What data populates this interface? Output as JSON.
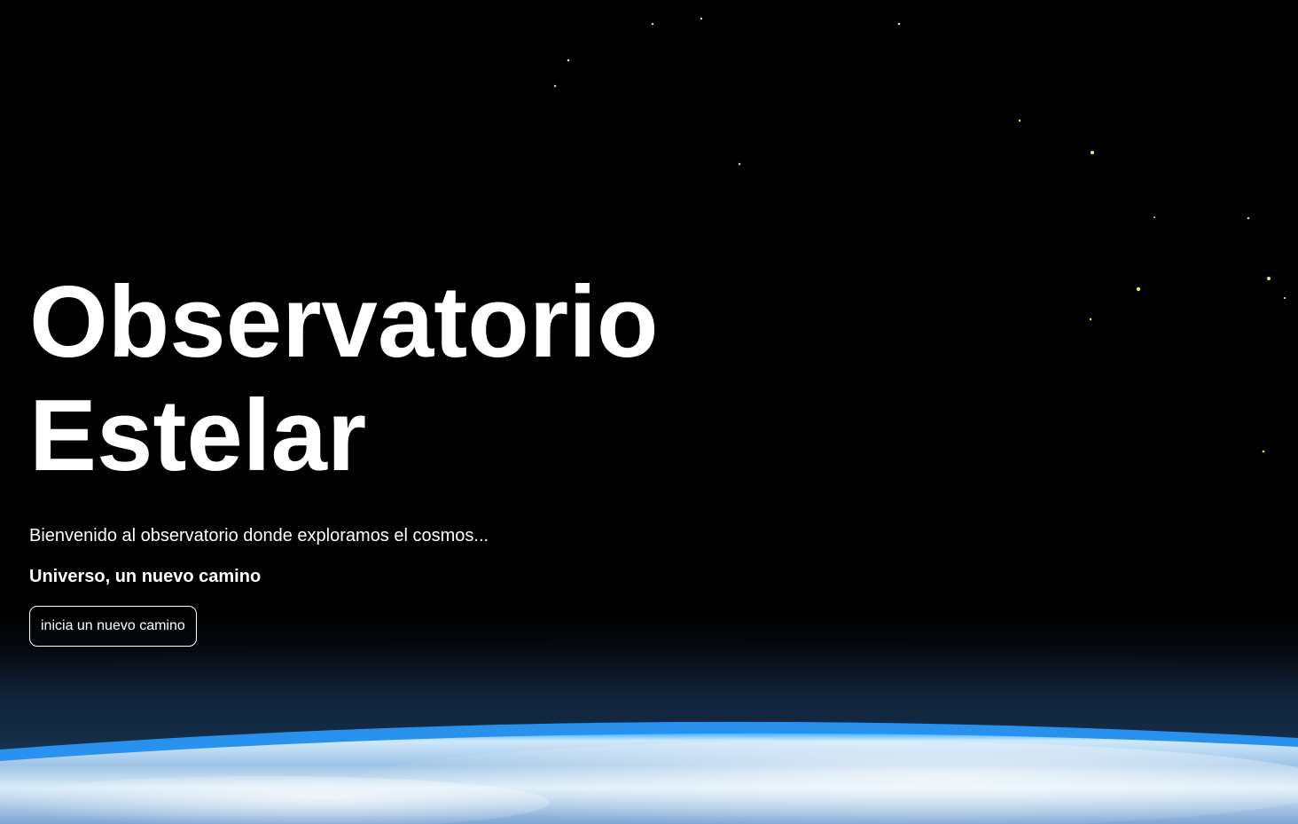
{
  "hero": {
    "title_line1": "Observatorio",
    "title_line2": "Estelar",
    "subtitle": "Bienvenido al observatorio donde exploramos el cosmos...",
    "tagline": "Universo, un nuevo camino",
    "cta_label": "inicia un nuevo camino"
  },
  "colors": {
    "background": "#000000",
    "text": "#ffffff",
    "star": "#f2e65a",
    "atmosphere": "#2a9cff"
  }
}
